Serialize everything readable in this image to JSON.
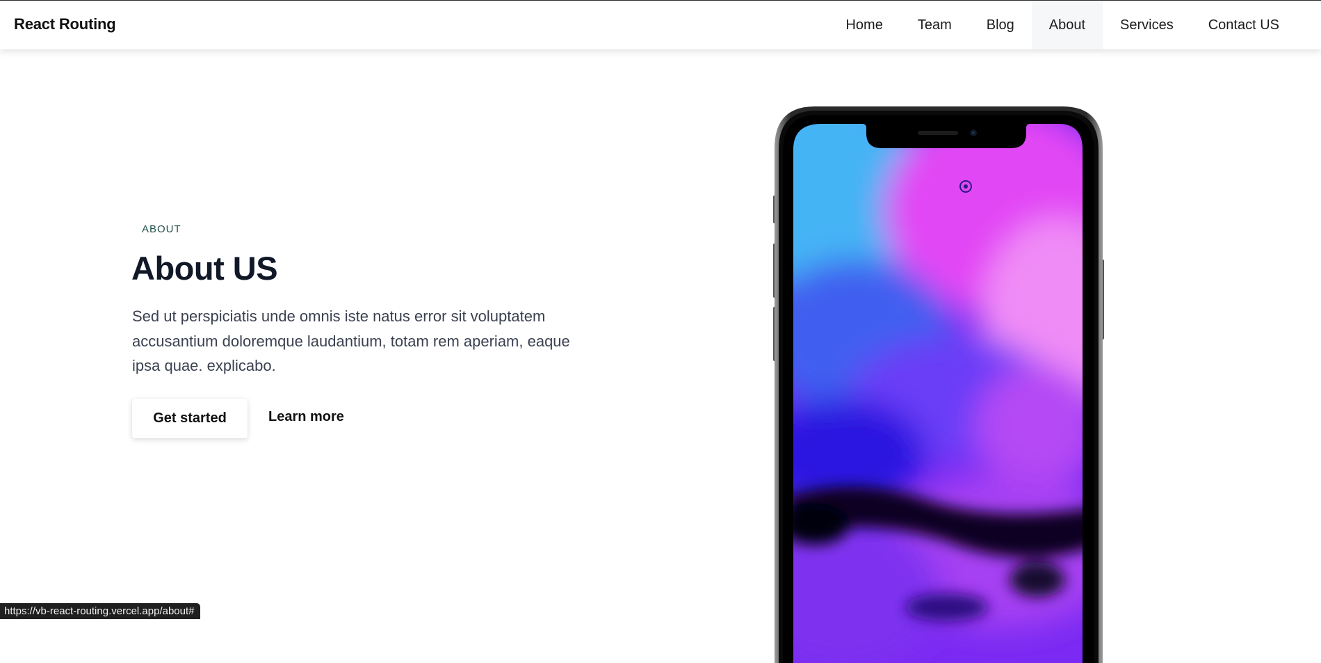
{
  "navbar": {
    "brand": "React Routing",
    "links": [
      {
        "label": "Home",
        "active": false
      },
      {
        "label": "Team",
        "active": false
      },
      {
        "label": "Blog",
        "active": false
      },
      {
        "label": "About",
        "active": true
      },
      {
        "label": "Services",
        "active": false
      },
      {
        "label": "Contact US",
        "active": false
      }
    ]
  },
  "hero": {
    "eyebrow": "ABOUT",
    "title": "About US",
    "description": "Sed ut perspiciatis unde omnis iste natus error sit voluptatem accusantium doloremque laudantium, totam rem aperiam, eaque ipsa quae. explicabo.",
    "primary_button": "Get started",
    "secondary_link": "Learn more"
  },
  "phone": {
    "icon": "smartphone-mockup",
    "wallpaper_colors": [
      "#3fa7f0",
      "#d040f5",
      "#2a10d8",
      "#0b0520",
      "#9a3af0"
    ]
  },
  "status_bar": {
    "url": "https://vb-react-routing.vercel.app/about#"
  }
}
